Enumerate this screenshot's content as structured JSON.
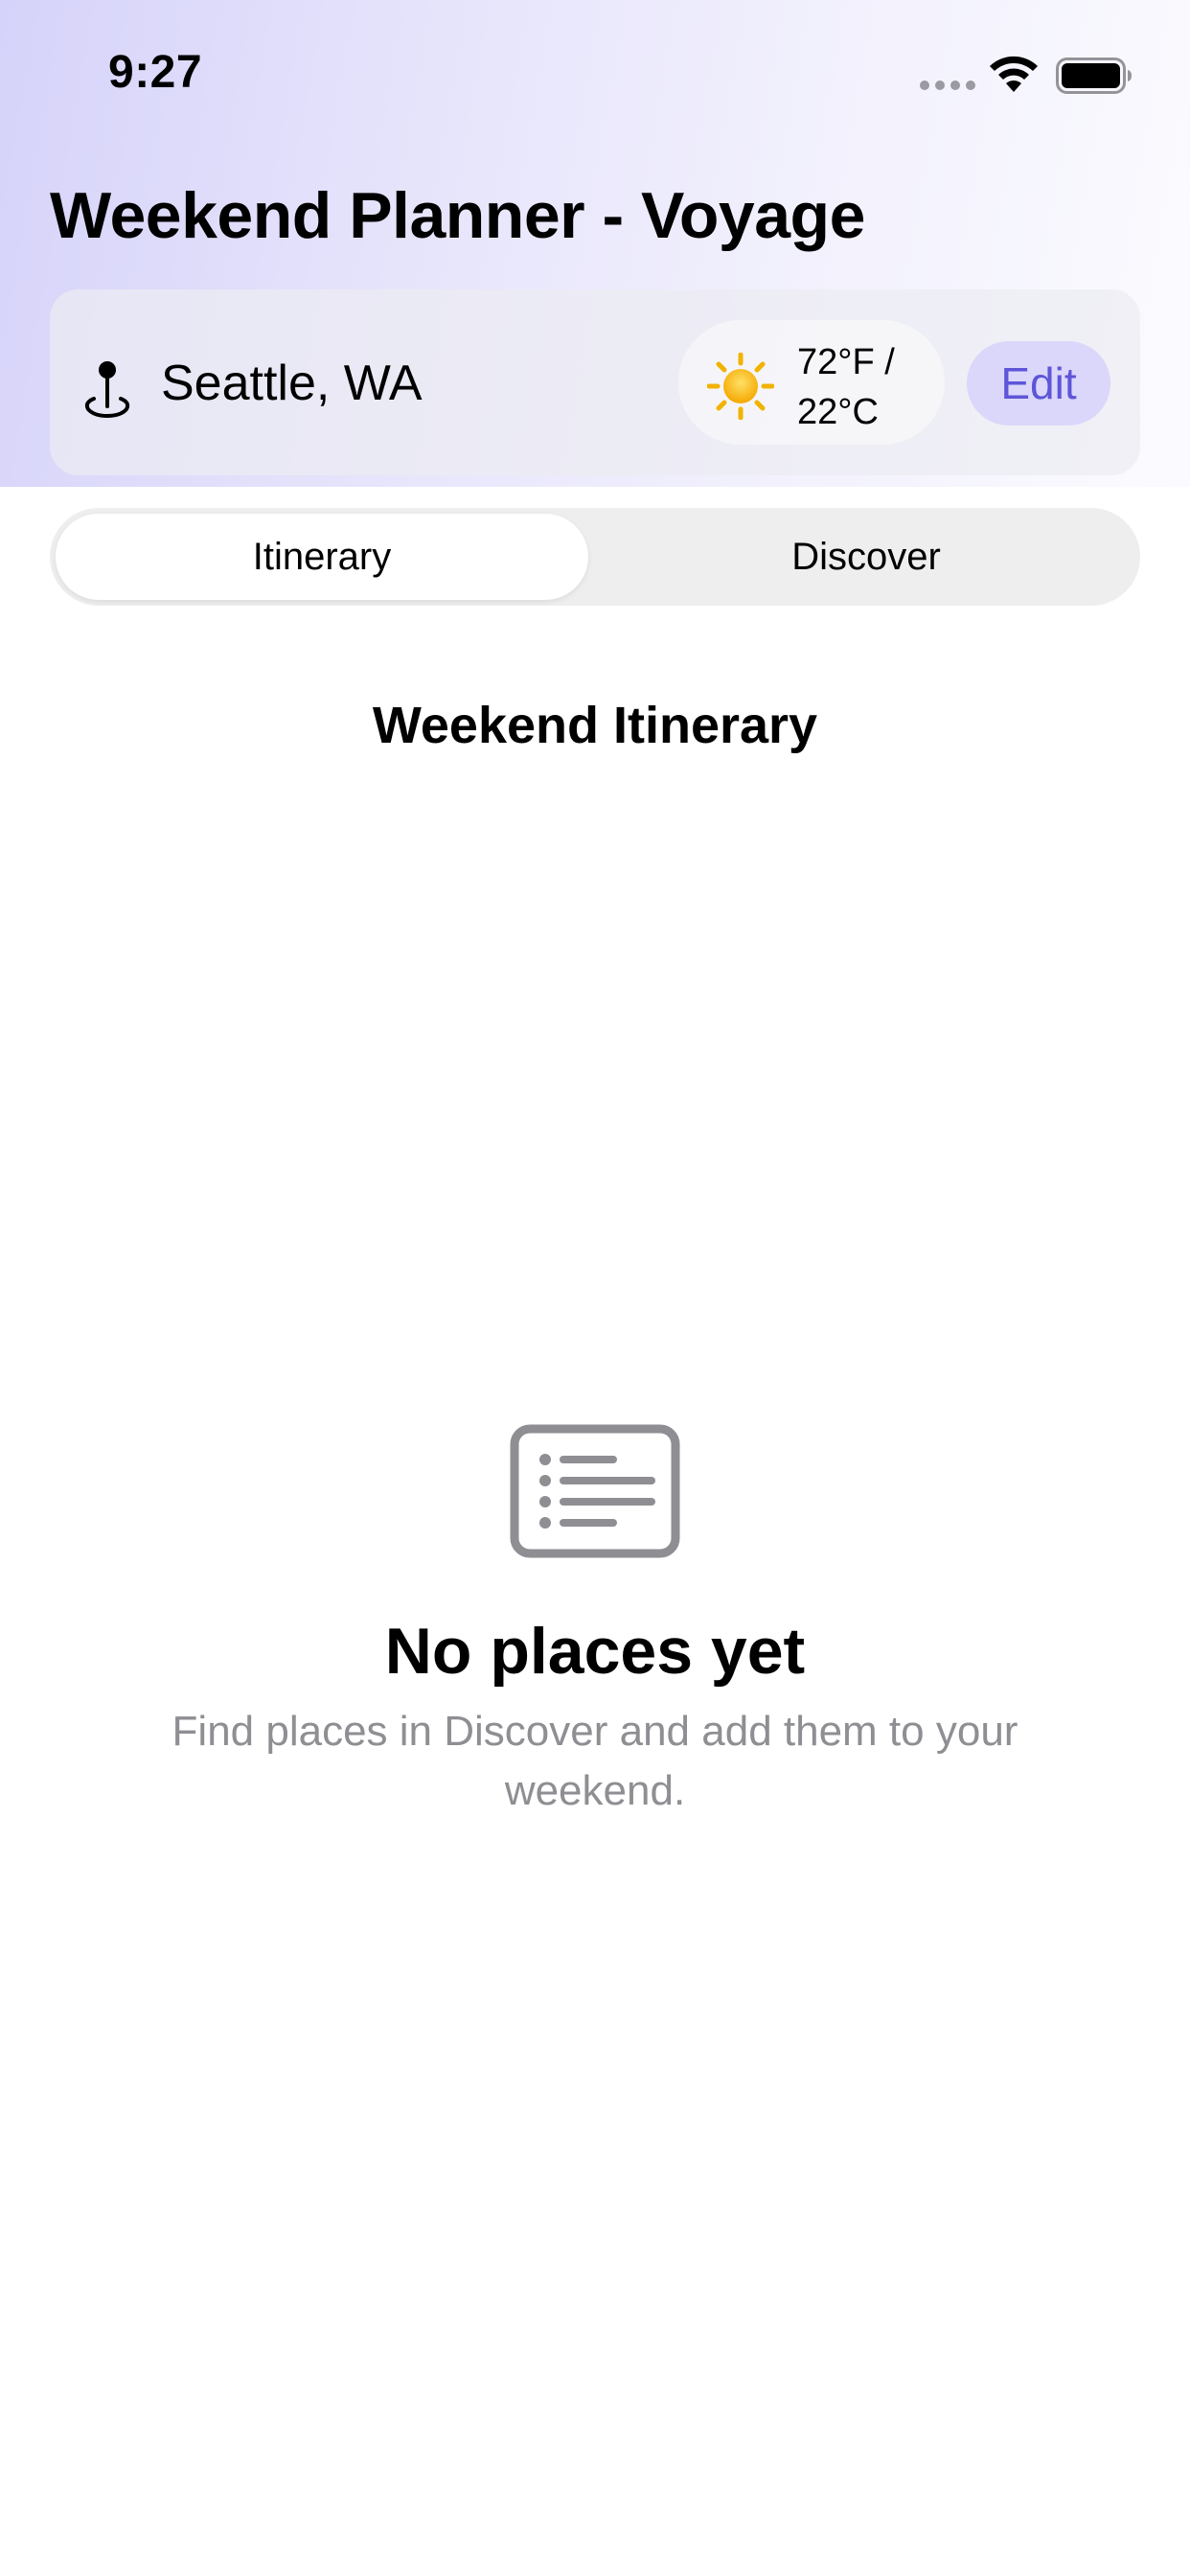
{
  "status_bar": {
    "time": "9:27",
    "icons": [
      "signal-dots-icon",
      "wifi-icon",
      "battery-icon"
    ]
  },
  "header": {
    "title": "Weekend Planner - Voyage",
    "location": {
      "icon": "map-pin-icon",
      "name": "Seattle, WA"
    },
    "weather": {
      "icon": "sun-icon",
      "temp_line1": "72°F /",
      "temp_line2": "22°C"
    },
    "edit_label": "Edit"
  },
  "tabs": [
    {
      "label": "Itinerary",
      "selected": true
    },
    {
      "label": "Discover",
      "selected": false
    }
  ],
  "main": {
    "section_title": "Weekend Itinerary",
    "empty_state": {
      "icon": "list-icon",
      "title": "No places yet",
      "subtitle": "Find places in Discover and add them to your weekend."
    }
  },
  "colors": {
    "accent": "#5e55d8",
    "accent_bg": "#dad7fa",
    "header_gradient_start": "#d6d3fa",
    "secondary_text": "#8e8e93"
  }
}
